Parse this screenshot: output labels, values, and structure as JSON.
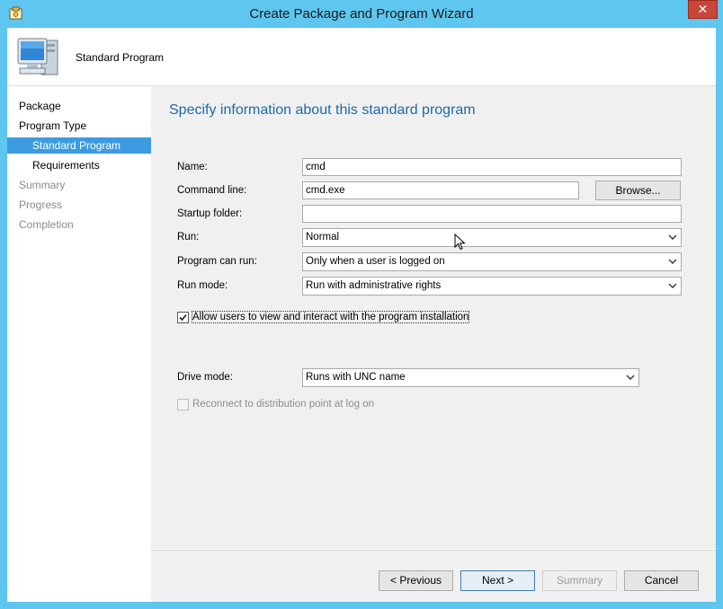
{
  "window": {
    "title": "Create Package and Program Wizard",
    "close_glyph": "✕"
  },
  "header": {
    "title": "Standard Program",
    "icon": "computer-icon"
  },
  "nav": {
    "items": [
      {
        "label": "Package",
        "state": "normal"
      },
      {
        "label": "Program Type",
        "state": "normal"
      },
      {
        "label": "Standard Program",
        "state": "selected"
      },
      {
        "label": "Requirements",
        "state": "normal"
      },
      {
        "label": "Summary",
        "state": "disabled"
      },
      {
        "label": "Progress",
        "state": "disabled"
      },
      {
        "label": "Completion",
        "state": "disabled"
      }
    ]
  },
  "page": {
    "heading": "Specify information about this standard program",
    "name_label": "Name:",
    "name_value": "cmd",
    "command_line_label": "Command line:",
    "command_line_value": "cmd.exe",
    "browse_label": "Browse...",
    "startup_folder_label": "Startup folder:",
    "startup_folder_value": "",
    "run_label": "Run:",
    "run_value": "Normal",
    "program_can_run_label": "Program can run:",
    "program_can_run_value": "Only when a user is logged on",
    "run_mode_label": "Run mode:",
    "run_mode_value": "Run with administrative rights",
    "allow_interact_label": "Allow users to view and interact with the program installation",
    "allow_interact_checked": true,
    "drive_mode_label": "Drive mode:",
    "drive_mode_value": "Runs with UNC name",
    "reconnect_label": "Reconnect to distribution point at log on",
    "reconnect_checked": false
  },
  "footer": {
    "previous_label": "< Previous",
    "next_label": "Next >",
    "summary_label": "Summary",
    "cancel_label": "Cancel"
  },
  "colors": {
    "title_bar": "#5ec6ef",
    "heading": "#1e6aa8",
    "nav_selected": "#3c9be0"
  }
}
